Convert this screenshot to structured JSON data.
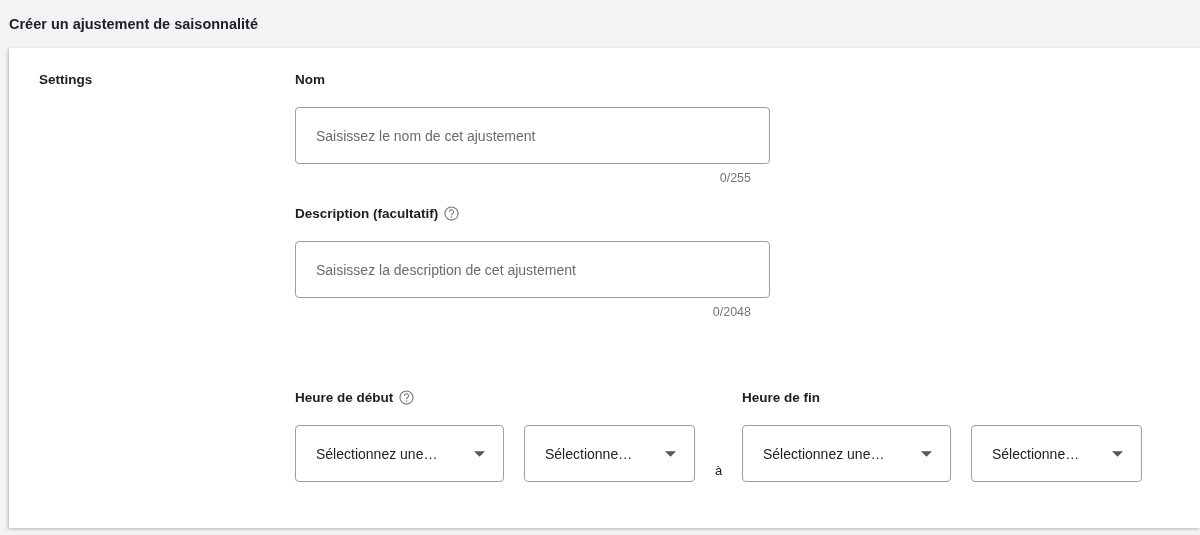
{
  "header": {
    "title": "Créer un ajustement de saisonnalité"
  },
  "section": {
    "label": "Settings"
  },
  "fields": [
    {
      "label": "Nom",
      "help": false,
      "placeholder": "Saisissez le nom de cet ajustement",
      "counter": "0/255"
    },
    {
      "label": "Description (facultatif)",
      "help": true,
      "placeholder": "Saisissez la description de cet ajustement",
      "counter": "0/2048"
    }
  ],
  "time": {
    "separator": "à",
    "groups": [
      {
        "label": "Heure de début",
        "help": true,
        "selects": [
          "Sélectionnez une…",
          "Sélectionne…"
        ]
      },
      {
        "label": "Heure de fin",
        "help": false,
        "selects": [
          "Sélectionnez une…",
          "Sélectionne…"
        ]
      }
    ]
  }
}
